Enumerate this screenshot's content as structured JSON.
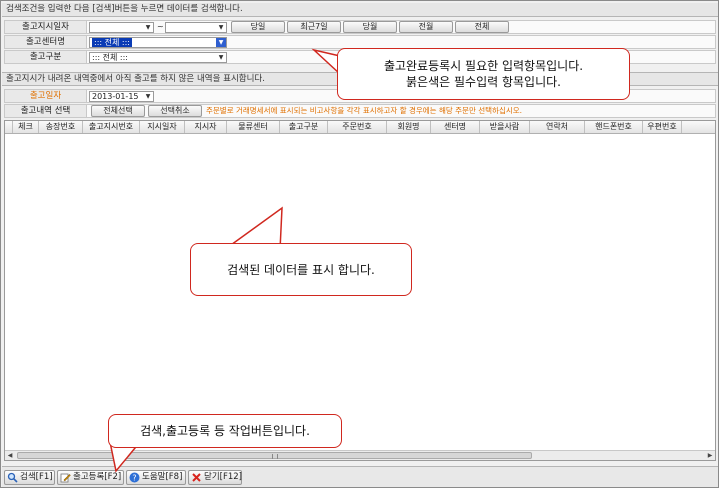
{
  "search": {
    "hint": "검색조건을 입력한 다음 [검색]버튼을 누르면 데이터를 검색합니다.",
    "rows": [
      {
        "label": "출고지시일자",
        "from_value": "",
        "to_value": "",
        "separator": "~"
      },
      {
        "label": "출고센터명",
        "value": "::: 전체 :::"
      },
      {
        "label": "출고구분",
        "value": "::: 전체 :::"
      }
    ],
    "date_buttons": [
      "당일",
      "최근7일",
      "당월",
      "전월",
      "전체"
    ]
  },
  "list": {
    "hint": "출고지시가 내려온 내역중에서 아직 출고를 하지 않은 내역을 표시합니다.",
    "date_label": "출고일자",
    "date_value": "2013-01-15",
    "select_label": "출고내역 선택",
    "select_all": "전체선택",
    "deselect": "선택취소",
    "notice": "주문별로 거래명세서에 표시되는 비고사항을 각각 표시하고자 할 경우에는 해당 주문만 선택하십시오."
  },
  "grid": {
    "columns": [
      "체크",
      "송장번호",
      "출고지시번호",
      "지시일자",
      "지시자",
      "물류센터",
      "출고구분",
      "주문번호",
      "회원명",
      "센터명",
      "받을사람",
      "연락처",
      "핸드폰번호",
      "우편번호"
    ]
  },
  "toolbar": {
    "buttons": [
      {
        "label": "검색[F1]",
        "icon": "search-icon"
      },
      {
        "label": "출고등록[F2]",
        "icon": "pencil-icon"
      },
      {
        "label": "도움말[F8]",
        "icon": "help-icon"
      },
      {
        "label": "닫기[F12]",
        "icon": "close-icon"
      }
    ]
  },
  "callouts": {
    "required_line1": "출고완료등록시 필요한 입력항목입니다.",
    "required_line2": "붉은색은 필수입력 항목입니다.",
    "grid_note": "검색된 데이터를 표시 합니다.",
    "toolbar_note": "검색,출고등록 등 작업버튼입니다."
  },
  "colors": {
    "required_label": "#e07000",
    "callout_border": "#d0281f",
    "selection": "#0a3bb5"
  }
}
